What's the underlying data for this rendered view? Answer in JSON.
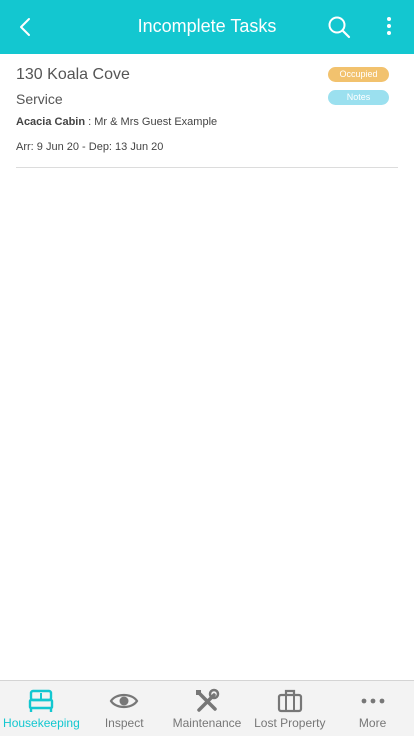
{
  "header": {
    "title": "Incomplete Tasks",
    "back_icon": "chevron-left-icon",
    "search_icon": "search-icon",
    "menu_icon": "more-vertical-icon",
    "color": "#13c7d0"
  },
  "task": {
    "room": "130 Koala Cove",
    "type": "Service",
    "cabin": "Acacia Cabin",
    "separator": " : ",
    "guest": "Mr & Mrs Guest Example",
    "dates": "Arr: 9 Jun 20 - Dep: 13 Jun 20",
    "status_badge": "Occupied",
    "notes_badge": "Notes",
    "status_color": "#f2c26e",
    "notes_color": "#9be0ef"
  },
  "tabbar": {
    "active": "Housekeeping",
    "items": [
      {
        "label": "Housekeeping",
        "icon": "bed-icon"
      },
      {
        "label": "Inspect",
        "icon": "eye-icon"
      },
      {
        "label": "Maintenance",
        "icon": "tools-icon"
      },
      {
        "label": "Lost Property",
        "icon": "briefcase-icon"
      },
      {
        "label": "More",
        "icon": "more-horizontal-icon"
      }
    ]
  }
}
